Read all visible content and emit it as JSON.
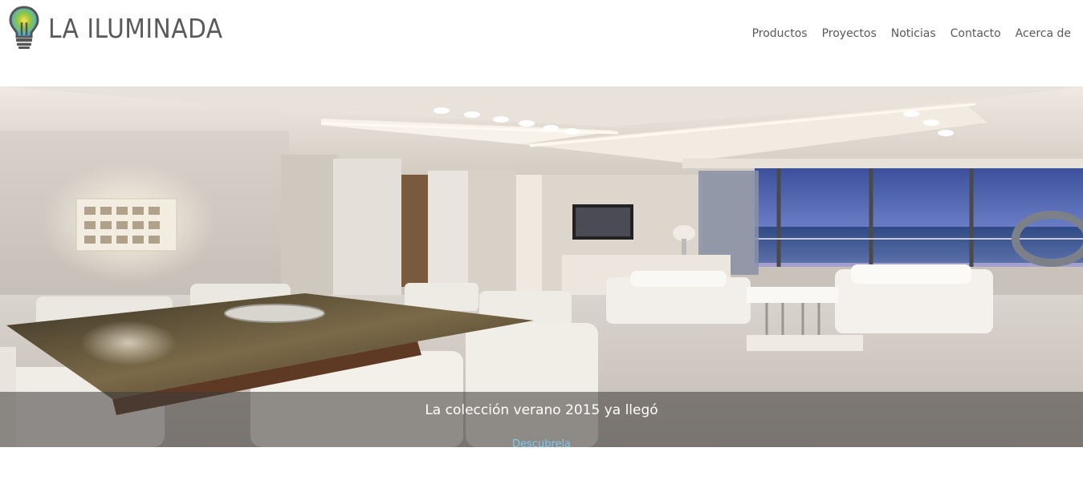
{
  "brand": {
    "name": "LA ILUMINADA",
    "logo_icon": "lightbulb-icon"
  },
  "nav": {
    "items": [
      {
        "label": "Productos"
      },
      {
        "label": "Proyectos"
      },
      {
        "label": "Noticias"
      },
      {
        "label": "Contacto"
      },
      {
        "label": "Acerca de"
      }
    ]
  },
  "hero": {
    "caption_title": "La colección verano 2015 ya llegó",
    "caption_link": "Descubrela"
  },
  "section": {
    "heading": ""
  },
  "colors": {
    "text": "#5a5a5a",
    "link": "#7ec6f2",
    "caption_bg": "#3c3a38",
    "bulb_green": "#8dc63f",
    "bulb_yellow": "#ffe14d",
    "bulb_blue": "#3fa9f5"
  }
}
